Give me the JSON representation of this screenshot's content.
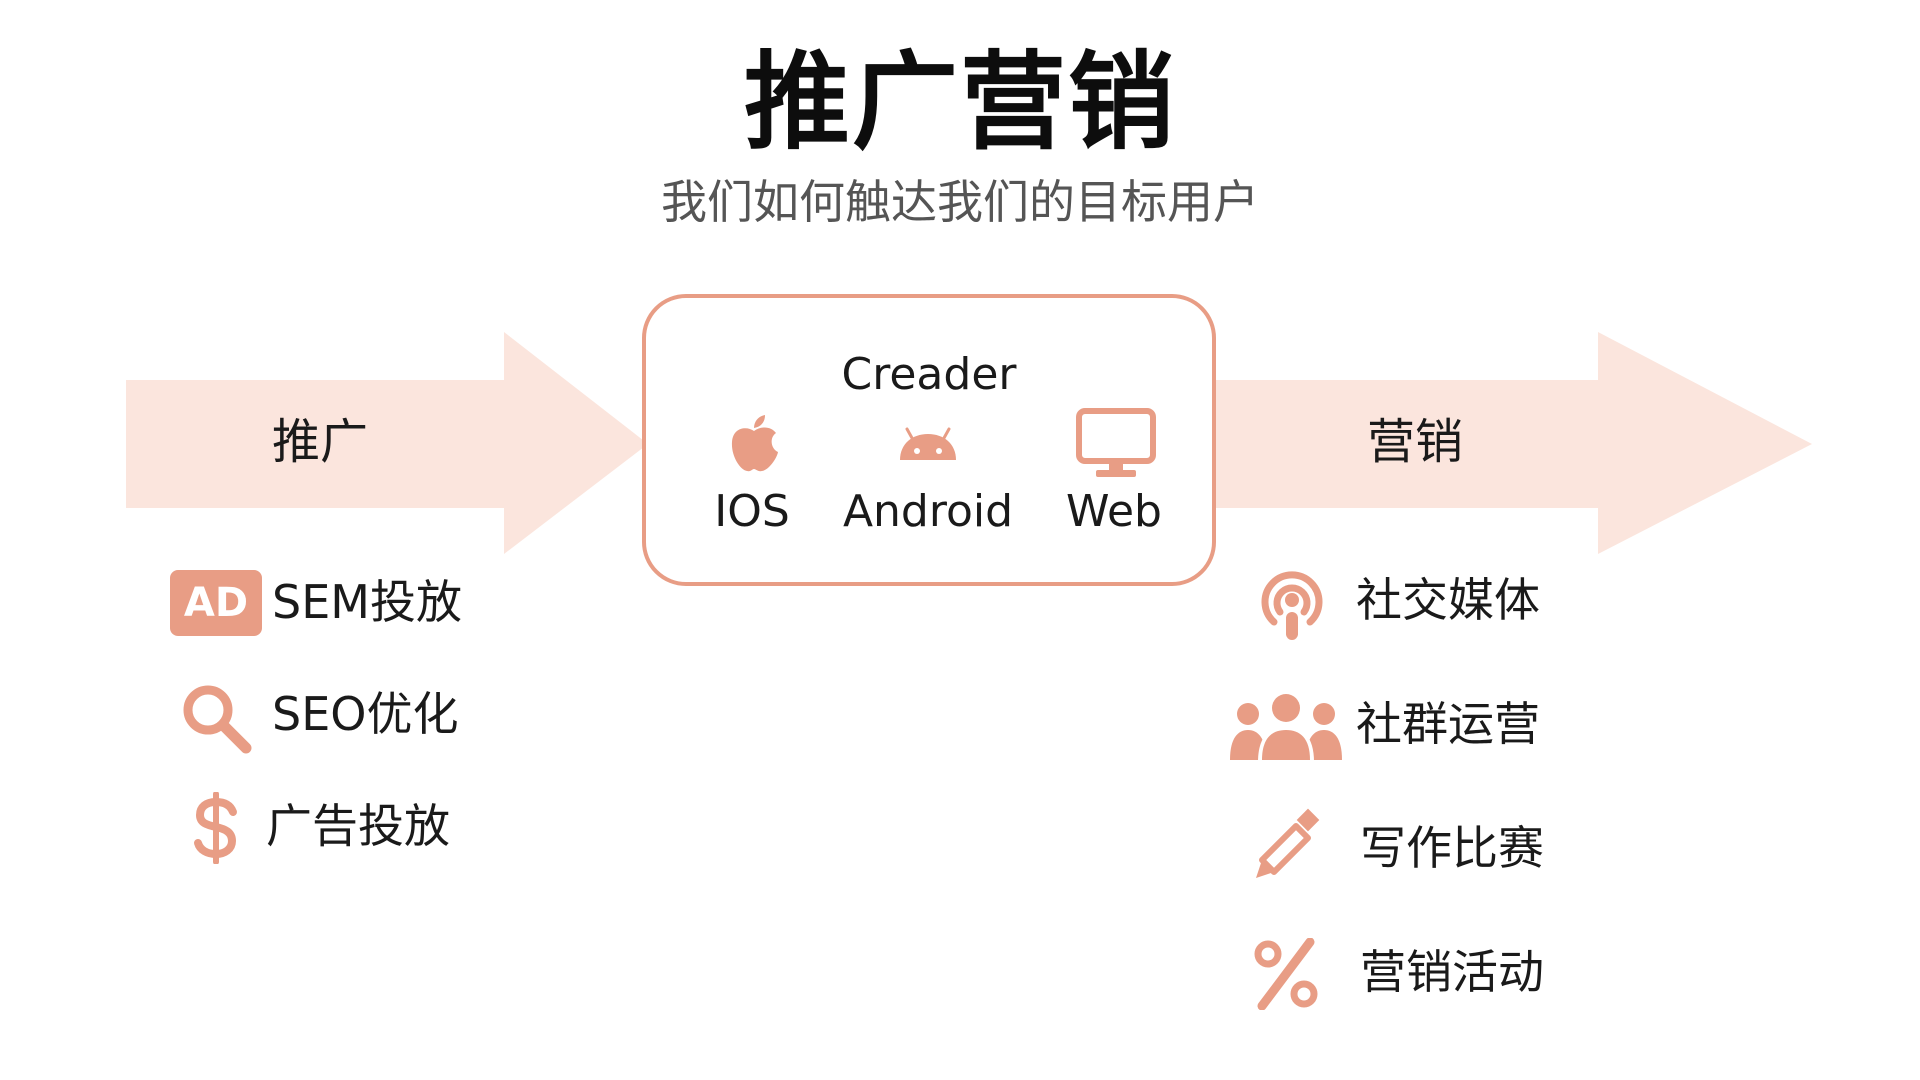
{
  "header": {
    "title": "推广营销",
    "subtitle": "我们如何触达我们的目标用户"
  },
  "colors": {
    "accent": "#e89d85",
    "arrow_fill": "#fbe5dd",
    "title_text": "#0d0d0d",
    "subtitle_text": "#555555"
  },
  "promotion": {
    "label": "推广",
    "items": [
      {
        "icon": "ad-badge-icon",
        "badge": "AD",
        "label": "SEM投放"
      },
      {
        "icon": "search-icon",
        "label": "SEO优化"
      },
      {
        "icon": "dollar-icon",
        "label": "广告投放"
      }
    ]
  },
  "product": {
    "name": "Creader",
    "platforms": [
      {
        "icon": "apple-icon",
        "label": "IOS"
      },
      {
        "icon": "android-icon",
        "label": "Android"
      },
      {
        "icon": "monitor-icon",
        "label": "Web"
      }
    ]
  },
  "marketing": {
    "label": "营销",
    "items": [
      {
        "icon": "podcast-icon",
        "label": "社交媒体"
      },
      {
        "icon": "users-icon",
        "label": "社群运营"
      },
      {
        "icon": "pencil-icon",
        "label": "写作比赛"
      },
      {
        "icon": "percent-icon",
        "label": "营销活动"
      }
    ]
  }
}
